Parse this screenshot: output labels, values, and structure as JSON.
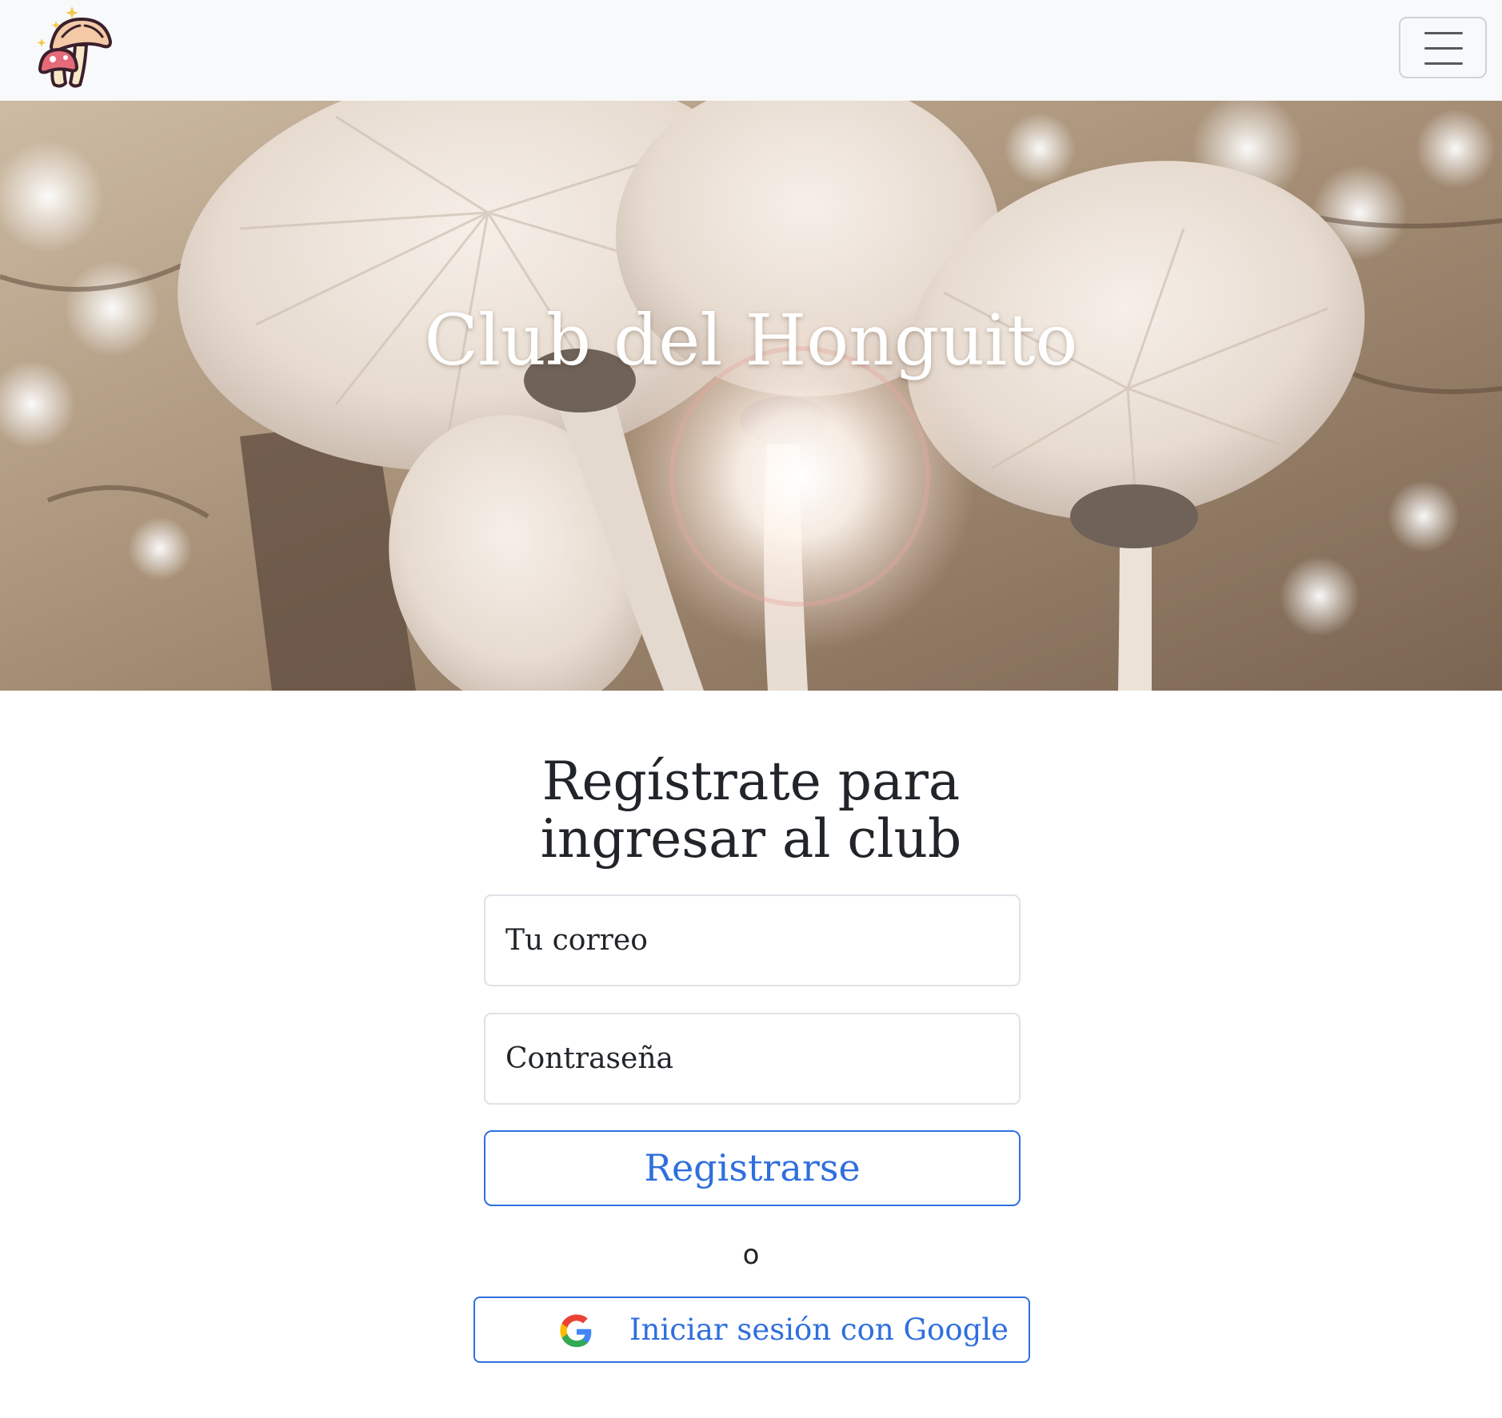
{
  "navbar": {
    "logo": "mushroom-logo-icon",
    "menu_icon": "hamburger-menu-icon"
  },
  "hero": {
    "title": "Club del Honguito",
    "image": "mushrooms-backlit-photo"
  },
  "signup": {
    "heading_line1": "Regístrate para",
    "heading_line2": "ingresar al club",
    "email_placeholder": "Tu correo",
    "password_placeholder": "Contraseña",
    "register_label": "Registrarse",
    "or_text": "o",
    "google_label": "Iniciar sesión con Google",
    "google_icon": "google-g-icon"
  },
  "colors": {
    "accent": "#2f6fde",
    "navbar_bg": "#f8f9fa",
    "text": "#212529",
    "border": "#dee2e6"
  }
}
